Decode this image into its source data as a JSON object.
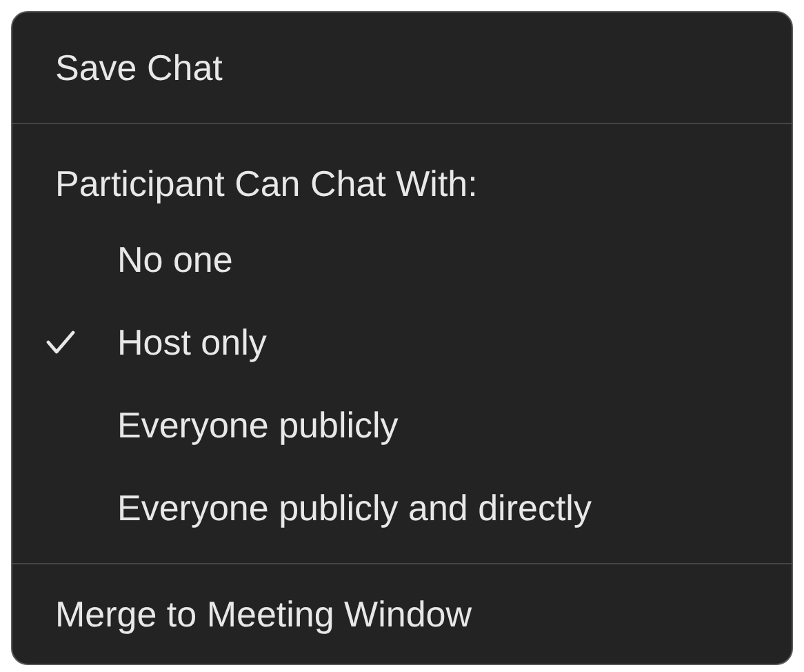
{
  "menu": {
    "top_item": "Save Chat",
    "section_header": "Participant Can Chat With:",
    "options": [
      {
        "label": "No one",
        "checked": false
      },
      {
        "label": "Host only",
        "checked": true
      },
      {
        "label": "Everyone publicly",
        "checked": false
      },
      {
        "label": "Everyone publicly and directly",
        "checked": false
      }
    ],
    "bottom_item": "Merge to Meeting Window"
  }
}
